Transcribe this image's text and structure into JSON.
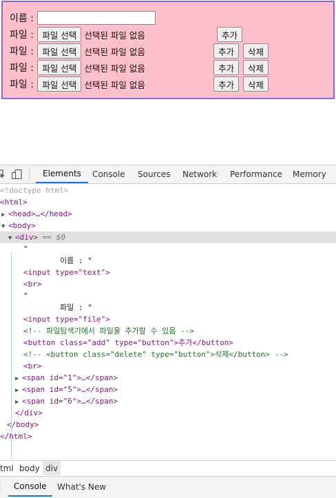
{
  "form": {
    "name_label": "이름 : ",
    "file_label": "파일 : ",
    "file_button": "파일 선택",
    "no_file": "선택된 파일 없음",
    "add_button": "추가",
    "delete_button": "삭제"
  },
  "devtools": {
    "tabs": [
      "Elements",
      "Console",
      "Sources",
      "Network",
      "Performance",
      "Memory"
    ],
    "active_tab": "Elements",
    "tree": [
      {
        "t": "<!doctype html>"
      },
      {
        "t": "<html>"
      },
      {
        "t": "<head>…</head>"
      },
      {
        "t": "<body>"
      },
      {
        "t": "<div>",
        "sel": "== $0"
      },
      {
        "t": "\""
      },
      {
        "t": "        이름 : \""
      },
      {
        "t": "<input type=\"text\">"
      },
      {
        "t": "<br>"
      },
      {
        "t": "\""
      },
      {
        "t": "        파일 : \""
      },
      {
        "t": "<input type=\"file\">"
      },
      {
        "t": "<!-- 파일탐색기에서 파일을 추가할 수 있음 -->"
      },
      {
        "t": "<button class=\"add\" type=\"button\">추가</button>"
      },
      {
        "t": "<!-- <button class=\"delete\" type=\"button\">삭제</button> -->"
      },
      {
        "t": "<br>"
      },
      {
        "t": "<span id=\"1\">…</span>"
      },
      {
        "t": "<span id=\"5\">…</span>"
      },
      {
        "t": "<span id=\"6\">…</span>"
      },
      {
        "t": "</div>"
      },
      {
        "t": "</body>"
      },
      {
        "t": "</html>"
      }
    ],
    "breadcrumbs": [
      "tml",
      "body",
      "div"
    ],
    "drawer_tabs": [
      "Console",
      "What's New"
    ]
  }
}
